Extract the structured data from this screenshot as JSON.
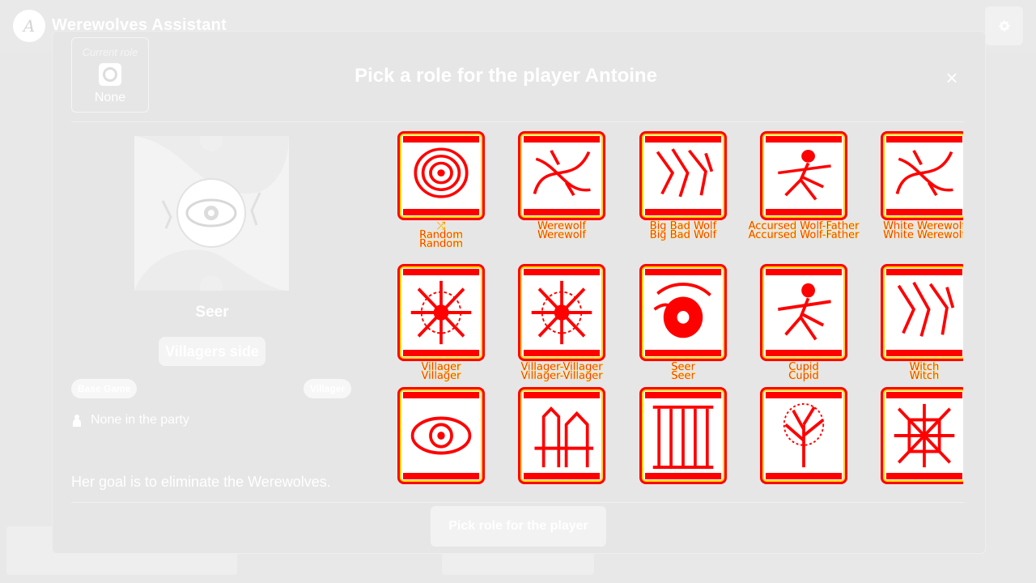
{
  "app": {
    "title": "Werewolves Assistant",
    "logo_glyph": "A"
  },
  "topbar": {
    "settings_icon": "gear-icon"
  },
  "modal": {
    "title": "Pick a role for the player Antoine",
    "close_glyph": "×",
    "current_role": {
      "label": "Current role",
      "value": "None"
    },
    "selected_role": {
      "name": "Seer",
      "side": "Villagers side",
      "tag_left": "Base Game",
      "tag_right": "Villager",
      "party_text": "None in the party",
      "description": "Her goal is to eliminate the Werewolves."
    },
    "roles": [
      {
        "label": "Random",
        "art": "spiral",
        "shuffle": true
      },
      {
        "label": "Werewolf",
        "art": "swirl"
      },
      {
        "label": "Big Bad Wolf",
        "art": "claws"
      },
      {
        "label": "Accursed Wolf-Father",
        "art": "figure"
      },
      {
        "label": "White Werewolf",
        "art": "swirl"
      },
      {
        "label": "Villager",
        "art": "flower"
      },
      {
        "label": "Villager-Villager",
        "art": "flower"
      },
      {
        "label": "Seer",
        "art": "orb"
      },
      {
        "label": "Cupid",
        "art": "figure"
      },
      {
        "label": "Witch",
        "art": "claws"
      },
      {
        "label": "",
        "art": "eye"
      },
      {
        "label": "",
        "art": "tower"
      },
      {
        "label": "",
        "art": "columns"
      },
      {
        "label": "",
        "art": "tree"
      },
      {
        "label": "",
        "art": "knot"
      }
    ],
    "pick_button_label": "Pick role for the player"
  },
  "colors": {
    "background": "#e8e8e8",
    "card_red": "#ff0000",
    "card_yellow": "#ffd800"
  }
}
